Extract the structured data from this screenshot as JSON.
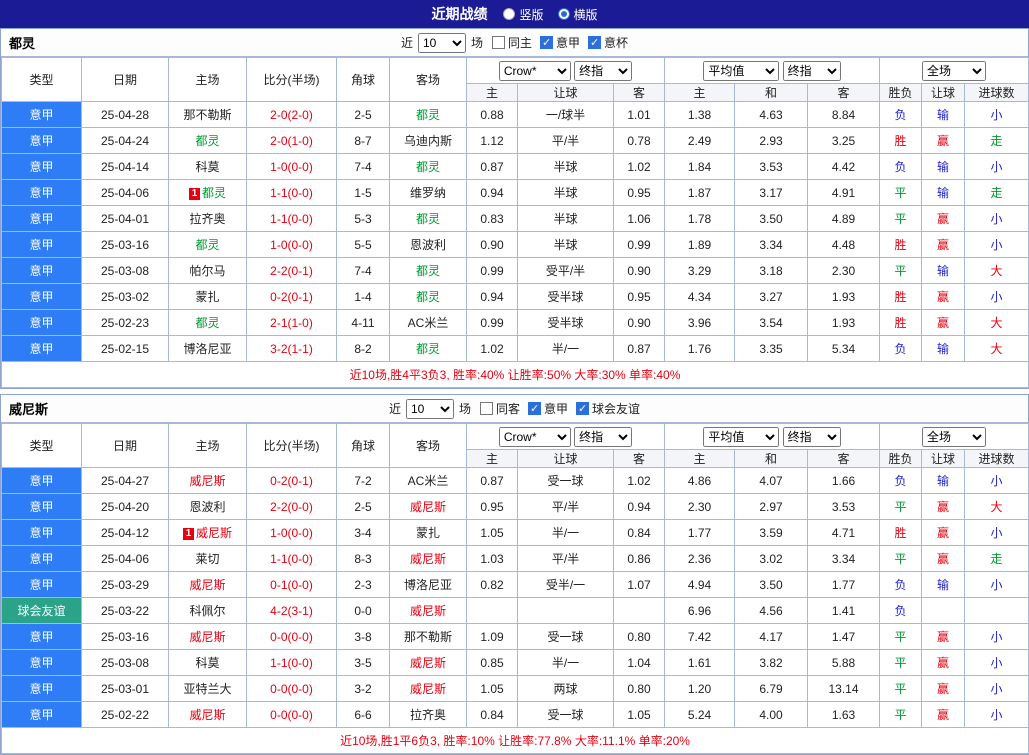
{
  "title_bar": {
    "title": "近期战绩",
    "modes": [
      {
        "label": "竖版",
        "selected": false
      },
      {
        "label": "横版",
        "selected": true
      }
    ]
  },
  "colors": {
    "titlebar_bg": "#1b1b96",
    "league_blue": "#2e7cf6",
    "friendly_teal": "#2ba389",
    "score_red": "#e60012",
    "team_green": "#009933",
    "team_red": "#e60012",
    "result_red": "#e60012",
    "result_blue": "#2323cc",
    "result_green": "#009933",
    "grid_border": "#a7b8d8"
  },
  "columns": [
    "类型",
    "日期",
    "主场",
    "比分(半场)",
    "角球",
    "客场",
    "主",
    "让球",
    "客",
    "主",
    "和",
    "客",
    "胜负",
    "让球",
    "进球数"
  ],
  "sections": [
    {
      "team": "都灵",
      "team_color": "team_green",
      "filter": {
        "near": "近",
        "count": "10",
        "games": "场",
        "checkboxes": [
          {
            "label": "同主",
            "checked": false
          },
          {
            "label": "意甲",
            "checked": true
          },
          {
            "label": "意杯",
            "checked": true
          }
        ]
      },
      "selects": {
        "bookmaker": "Crow*",
        "bookmaker_time": "终指",
        "europe_avg": "平均值",
        "europe_time": "终指",
        "scope": "全场"
      },
      "rows": [
        {
          "league": "意甲",
          "league_bg": "league_blue",
          "date": "25-04-28",
          "home": "那不勒斯",
          "home_is_team": false,
          "home_badge": "",
          "score": "2-0(2-0)",
          "corner": "2-5",
          "away": "都灵",
          "away_is_team": true,
          "away_badge": "",
          "asia": [
            "0.88",
            "一/球半",
            "1.01"
          ],
          "europe": [
            "1.38",
            "4.63",
            "8.84"
          ],
          "results": [
            {
              "text": "负",
              "color": "result_blue"
            },
            {
              "text": "输",
              "color": "result_blue"
            },
            {
              "text": "小",
              "color": "result_blue"
            }
          ]
        },
        {
          "league": "意甲",
          "league_bg": "league_blue",
          "date": "25-04-24",
          "home": "都灵",
          "home_is_team": true,
          "home_badge": "",
          "score": "2-0(1-0)",
          "corner": "8-7",
          "away": "乌迪内斯",
          "away_is_team": false,
          "away_badge": "",
          "asia": [
            "1.12",
            "平/半",
            "0.78"
          ],
          "europe": [
            "2.49",
            "2.93",
            "3.25"
          ],
          "results": [
            {
              "text": "胜",
              "color": "result_red"
            },
            {
              "text": "赢",
              "color": "result_red"
            },
            {
              "text": "走",
              "color": "result_green"
            }
          ]
        },
        {
          "league": "意甲",
          "league_bg": "league_blue",
          "date": "25-04-14",
          "home": "科莫",
          "home_is_team": false,
          "home_badge": "",
          "score": "1-0(0-0)",
          "corner": "7-4",
          "away": "都灵",
          "away_is_team": true,
          "away_badge": "",
          "asia": [
            "0.87",
            "半球",
            "1.02"
          ],
          "europe": [
            "1.84",
            "3.53",
            "4.42"
          ],
          "results": [
            {
              "text": "负",
              "color": "result_blue"
            },
            {
              "text": "输",
              "color": "result_blue"
            },
            {
              "text": "小",
              "color": "result_blue"
            }
          ]
        },
        {
          "league": "意甲",
          "league_bg": "league_blue",
          "date": "25-04-06",
          "home": "都灵",
          "home_is_team": true,
          "home_badge": "1",
          "score": "1-1(0-0)",
          "corner": "1-5",
          "away": "维罗纳",
          "away_is_team": false,
          "away_badge": "",
          "asia": [
            "0.94",
            "半球",
            "0.95"
          ],
          "europe": [
            "1.87",
            "3.17",
            "4.91"
          ],
          "results": [
            {
              "text": "平",
              "color": "result_green"
            },
            {
              "text": "输",
              "color": "result_blue"
            },
            {
              "text": "走",
              "color": "result_green"
            }
          ]
        },
        {
          "league": "意甲",
          "league_bg": "league_blue",
          "date": "25-04-01",
          "home": "拉齐奥",
          "home_is_team": false,
          "home_badge": "",
          "score": "1-1(0-0)",
          "corner": "5-3",
          "away": "都灵",
          "away_is_team": true,
          "away_badge": "",
          "asia": [
            "0.83",
            "半球",
            "1.06"
          ],
          "europe": [
            "1.78",
            "3.50",
            "4.89"
          ],
          "results": [
            {
              "text": "平",
              "color": "result_green"
            },
            {
              "text": "赢",
              "color": "result_red"
            },
            {
              "text": "小",
              "color": "result_blue"
            }
          ]
        },
        {
          "league": "意甲",
          "league_bg": "league_blue",
          "date": "25-03-16",
          "home": "都灵",
          "home_is_team": true,
          "home_badge": "",
          "score": "1-0(0-0)",
          "corner": "5-5",
          "away": "恩波利",
          "away_is_team": false,
          "away_badge": "",
          "asia": [
            "0.90",
            "半球",
            "0.99"
          ],
          "europe": [
            "1.89",
            "3.34",
            "4.48"
          ],
          "results": [
            {
              "text": "胜",
              "color": "result_red"
            },
            {
              "text": "赢",
              "color": "result_red"
            },
            {
              "text": "小",
              "color": "result_blue"
            }
          ]
        },
        {
          "league": "意甲",
          "league_bg": "league_blue",
          "date": "25-03-08",
          "home": "帕尔马",
          "home_is_team": false,
          "home_badge": "",
          "score": "2-2(0-1)",
          "corner": "7-4",
          "away": "都灵",
          "away_is_team": true,
          "away_badge": "",
          "asia": [
            "0.99",
            "受平/半",
            "0.90"
          ],
          "europe": [
            "3.29",
            "3.18",
            "2.30"
          ],
          "results": [
            {
              "text": "平",
              "color": "result_green"
            },
            {
              "text": "输",
              "color": "result_blue"
            },
            {
              "text": "大",
              "color": "result_red"
            }
          ]
        },
        {
          "league": "意甲",
          "league_bg": "league_blue",
          "date": "25-03-02",
          "home": "蒙扎",
          "home_is_team": false,
          "home_badge": "",
          "score": "0-2(0-1)",
          "corner": "1-4",
          "away": "都灵",
          "away_is_team": true,
          "away_badge": "",
          "asia": [
            "0.94",
            "受半球",
            "0.95"
          ],
          "europe": [
            "4.34",
            "3.27",
            "1.93"
          ],
          "results": [
            {
              "text": "胜",
              "color": "result_red"
            },
            {
              "text": "赢",
              "color": "result_red"
            },
            {
              "text": "小",
              "color": "result_blue"
            }
          ]
        },
        {
          "league": "意甲",
          "league_bg": "league_blue",
          "date": "25-02-23",
          "home": "都灵",
          "home_is_team": true,
          "home_badge": "",
          "score": "2-1(1-0)",
          "corner": "4-11",
          "away": "AC米兰",
          "away_is_team": false,
          "away_badge": "",
          "asia": [
            "0.99",
            "受半球",
            "0.90"
          ],
          "europe": [
            "3.96",
            "3.54",
            "1.93"
          ],
          "results": [
            {
              "text": "胜",
              "color": "result_red"
            },
            {
              "text": "赢",
              "color": "result_red"
            },
            {
              "text": "大",
              "color": "result_red"
            }
          ]
        },
        {
          "league": "意甲",
          "league_bg": "league_blue",
          "date": "25-02-15",
          "home": "博洛尼亚",
          "home_is_team": false,
          "home_badge": "",
          "score": "3-2(1-1)",
          "corner": "8-2",
          "away": "都灵",
          "away_is_team": true,
          "away_badge": "",
          "asia": [
            "1.02",
            "半/一",
            "0.87"
          ],
          "europe": [
            "1.76",
            "3.35",
            "5.34"
          ],
          "results": [
            {
              "text": "负",
              "color": "result_blue"
            },
            {
              "text": "输",
              "color": "result_blue"
            },
            {
              "text": "大",
              "color": "result_red"
            }
          ]
        }
      ],
      "summary": "近10场,胜4平3负3, 胜率:40% 让胜率:50% 大率:30% 单率:40%"
    },
    {
      "team": "威尼斯",
      "team_color": "team_red",
      "filter": {
        "near": "近",
        "count": "10",
        "games": "场",
        "checkboxes": [
          {
            "label": "同客",
            "checked": false
          },
          {
            "label": "意甲",
            "checked": true
          },
          {
            "label": "球会友谊",
            "checked": true
          }
        ]
      },
      "selects": {
        "bookmaker": "Crow*",
        "bookmaker_time": "终指",
        "europe_avg": "平均值",
        "europe_time": "终指",
        "scope": "全场"
      },
      "rows": [
        {
          "league": "意甲",
          "league_bg": "league_blue",
          "date": "25-04-27",
          "home": "威尼斯",
          "home_is_team": true,
          "home_badge": "",
          "score": "0-2(0-1)",
          "corner": "7-2",
          "away": "AC米兰",
          "away_is_team": false,
          "away_badge": "",
          "asia": [
            "0.87",
            "受一球",
            "1.02"
          ],
          "europe": [
            "4.86",
            "4.07",
            "1.66"
          ],
          "results": [
            {
              "text": "负",
              "color": "result_blue"
            },
            {
              "text": "输",
              "color": "result_blue"
            },
            {
              "text": "小",
              "color": "result_blue"
            }
          ]
        },
        {
          "league": "意甲",
          "league_bg": "league_blue",
          "date": "25-04-20",
          "home": "恩波利",
          "home_is_team": false,
          "home_badge": "",
          "score": "2-2(0-0)",
          "corner": "2-5",
          "away": "威尼斯",
          "away_is_team": true,
          "away_badge": "",
          "asia": [
            "0.95",
            "平/半",
            "0.94"
          ],
          "europe": [
            "2.30",
            "2.97",
            "3.53"
          ],
          "results": [
            {
              "text": "平",
              "color": "result_green"
            },
            {
              "text": "赢",
              "color": "result_red"
            },
            {
              "text": "大",
              "color": "result_red"
            }
          ]
        },
        {
          "league": "意甲",
          "league_bg": "league_blue",
          "date": "25-04-12",
          "home": "威尼斯",
          "home_is_team": true,
          "home_badge": "1",
          "score": "1-0(0-0)",
          "corner": "3-4",
          "away": "蒙扎",
          "away_is_team": false,
          "away_badge": "",
          "asia": [
            "1.05",
            "半/一",
            "0.84"
          ],
          "europe": [
            "1.77",
            "3.59",
            "4.71"
          ],
          "results": [
            {
              "text": "胜",
              "color": "result_red"
            },
            {
              "text": "赢",
              "color": "result_red"
            },
            {
              "text": "小",
              "color": "result_blue"
            }
          ]
        },
        {
          "league": "意甲",
          "league_bg": "league_blue",
          "date": "25-04-06",
          "home": "莱切",
          "home_is_team": false,
          "home_badge": "",
          "score": "1-1(0-0)",
          "corner": "8-3",
          "away": "威尼斯",
          "away_is_team": true,
          "away_badge": "",
          "asia": [
            "1.03",
            "平/半",
            "0.86"
          ],
          "europe": [
            "2.36",
            "3.02",
            "3.34"
          ],
          "results": [
            {
              "text": "平",
              "color": "result_green"
            },
            {
              "text": "赢",
              "color": "result_red"
            },
            {
              "text": "走",
              "color": "result_green"
            }
          ]
        },
        {
          "league": "意甲",
          "league_bg": "league_blue",
          "date": "25-03-29",
          "home": "威尼斯",
          "home_is_team": true,
          "home_badge": "",
          "score": "0-1(0-0)",
          "corner": "2-3",
          "away": "博洛尼亚",
          "away_is_team": false,
          "away_badge": "",
          "asia": [
            "0.82",
            "受半/一",
            "1.07"
          ],
          "europe": [
            "4.94",
            "3.50",
            "1.77"
          ],
          "results": [
            {
              "text": "负",
              "color": "result_blue"
            },
            {
              "text": "输",
              "color": "result_blue"
            },
            {
              "text": "小",
              "color": "result_blue"
            }
          ]
        },
        {
          "league": "球会友谊",
          "league_bg": "friendly_teal",
          "date": "25-03-22",
          "home": "科佩尔",
          "home_is_team": false,
          "home_badge": "",
          "score": "4-2(3-1)",
          "corner": "0-0",
          "away": "威尼斯",
          "away_is_team": true,
          "away_badge": "",
          "asia": [
            "",
            "",
            ""
          ],
          "europe": [
            "6.96",
            "4.56",
            "1.41"
          ],
          "results": [
            {
              "text": "负",
              "color": "result_blue"
            },
            {
              "text": "",
              "color": ""
            },
            {
              "text": "",
              "color": ""
            }
          ]
        },
        {
          "league": "意甲",
          "league_bg": "league_blue",
          "date": "25-03-16",
          "home": "威尼斯",
          "home_is_team": true,
          "home_badge": "",
          "score": "0-0(0-0)",
          "corner": "3-8",
          "away": "那不勒斯",
          "away_is_team": false,
          "away_badge": "",
          "asia": [
            "1.09",
            "受一球",
            "0.80"
          ],
          "europe": [
            "7.42",
            "4.17",
            "1.47"
          ],
          "results": [
            {
              "text": "平",
              "color": "result_green"
            },
            {
              "text": "赢",
              "color": "result_red"
            },
            {
              "text": "小",
              "color": "result_blue"
            }
          ]
        },
        {
          "league": "意甲",
          "league_bg": "league_blue",
          "date": "25-03-08",
          "home": "科莫",
          "home_is_team": false,
          "home_badge": "",
          "score": "1-1(0-0)",
          "corner": "3-5",
          "away": "威尼斯",
          "away_is_team": true,
          "away_badge": "",
          "asia": [
            "0.85",
            "半/一",
            "1.04"
          ],
          "europe": [
            "1.61",
            "3.82",
            "5.88"
          ],
          "results": [
            {
              "text": "平",
              "color": "result_green"
            },
            {
              "text": "赢",
              "color": "result_red"
            },
            {
              "text": "小",
              "color": "result_blue"
            }
          ]
        },
        {
          "league": "意甲",
          "league_bg": "league_blue",
          "date": "25-03-01",
          "home": "亚特兰大",
          "home_is_team": false,
          "home_badge": "",
          "score": "0-0(0-0)",
          "corner": "3-2",
          "away": "威尼斯",
          "away_is_team": true,
          "away_badge": "",
          "asia": [
            "1.05",
            "两球",
            "0.80"
          ],
          "europe": [
            "1.20",
            "6.79",
            "13.14"
          ],
          "results": [
            {
              "text": "平",
              "color": "result_green"
            },
            {
              "text": "赢",
              "color": "result_red"
            },
            {
              "text": "小",
              "color": "result_blue"
            }
          ]
        },
        {
          "league": "意甲",
          "league_bg": "league_blue",
          "date": "25-02-22",
          "home": "威尼斯",
          "home_is_team": true,
          "home_badge": "",
          "score": "0-0(0-0)",
          "corner": "6-6",
          "away": "拉齐奥",
          "away_is_team": false,
          "away_badge": "",
          "asia": [
            "0.84",
            "受一球",
            "1.05"
          ],
          "europe": [
            "5.24",
            "4.00",
            "1.63"
          ],
          "results": [
            {
              "text": "平",
              "color": "result_green"
            },
            {
              "text": "赢",
              "color": "result_red"
            },
            {
              "text": "小",
              "color": "result_blue"
            }
          ]
        }
      ],
      "summary": "近10场,胜1平6负3, 胜率:10% 让胜率:77.8% 大率:11.1% 单率:20%"
    }
  ]
}
